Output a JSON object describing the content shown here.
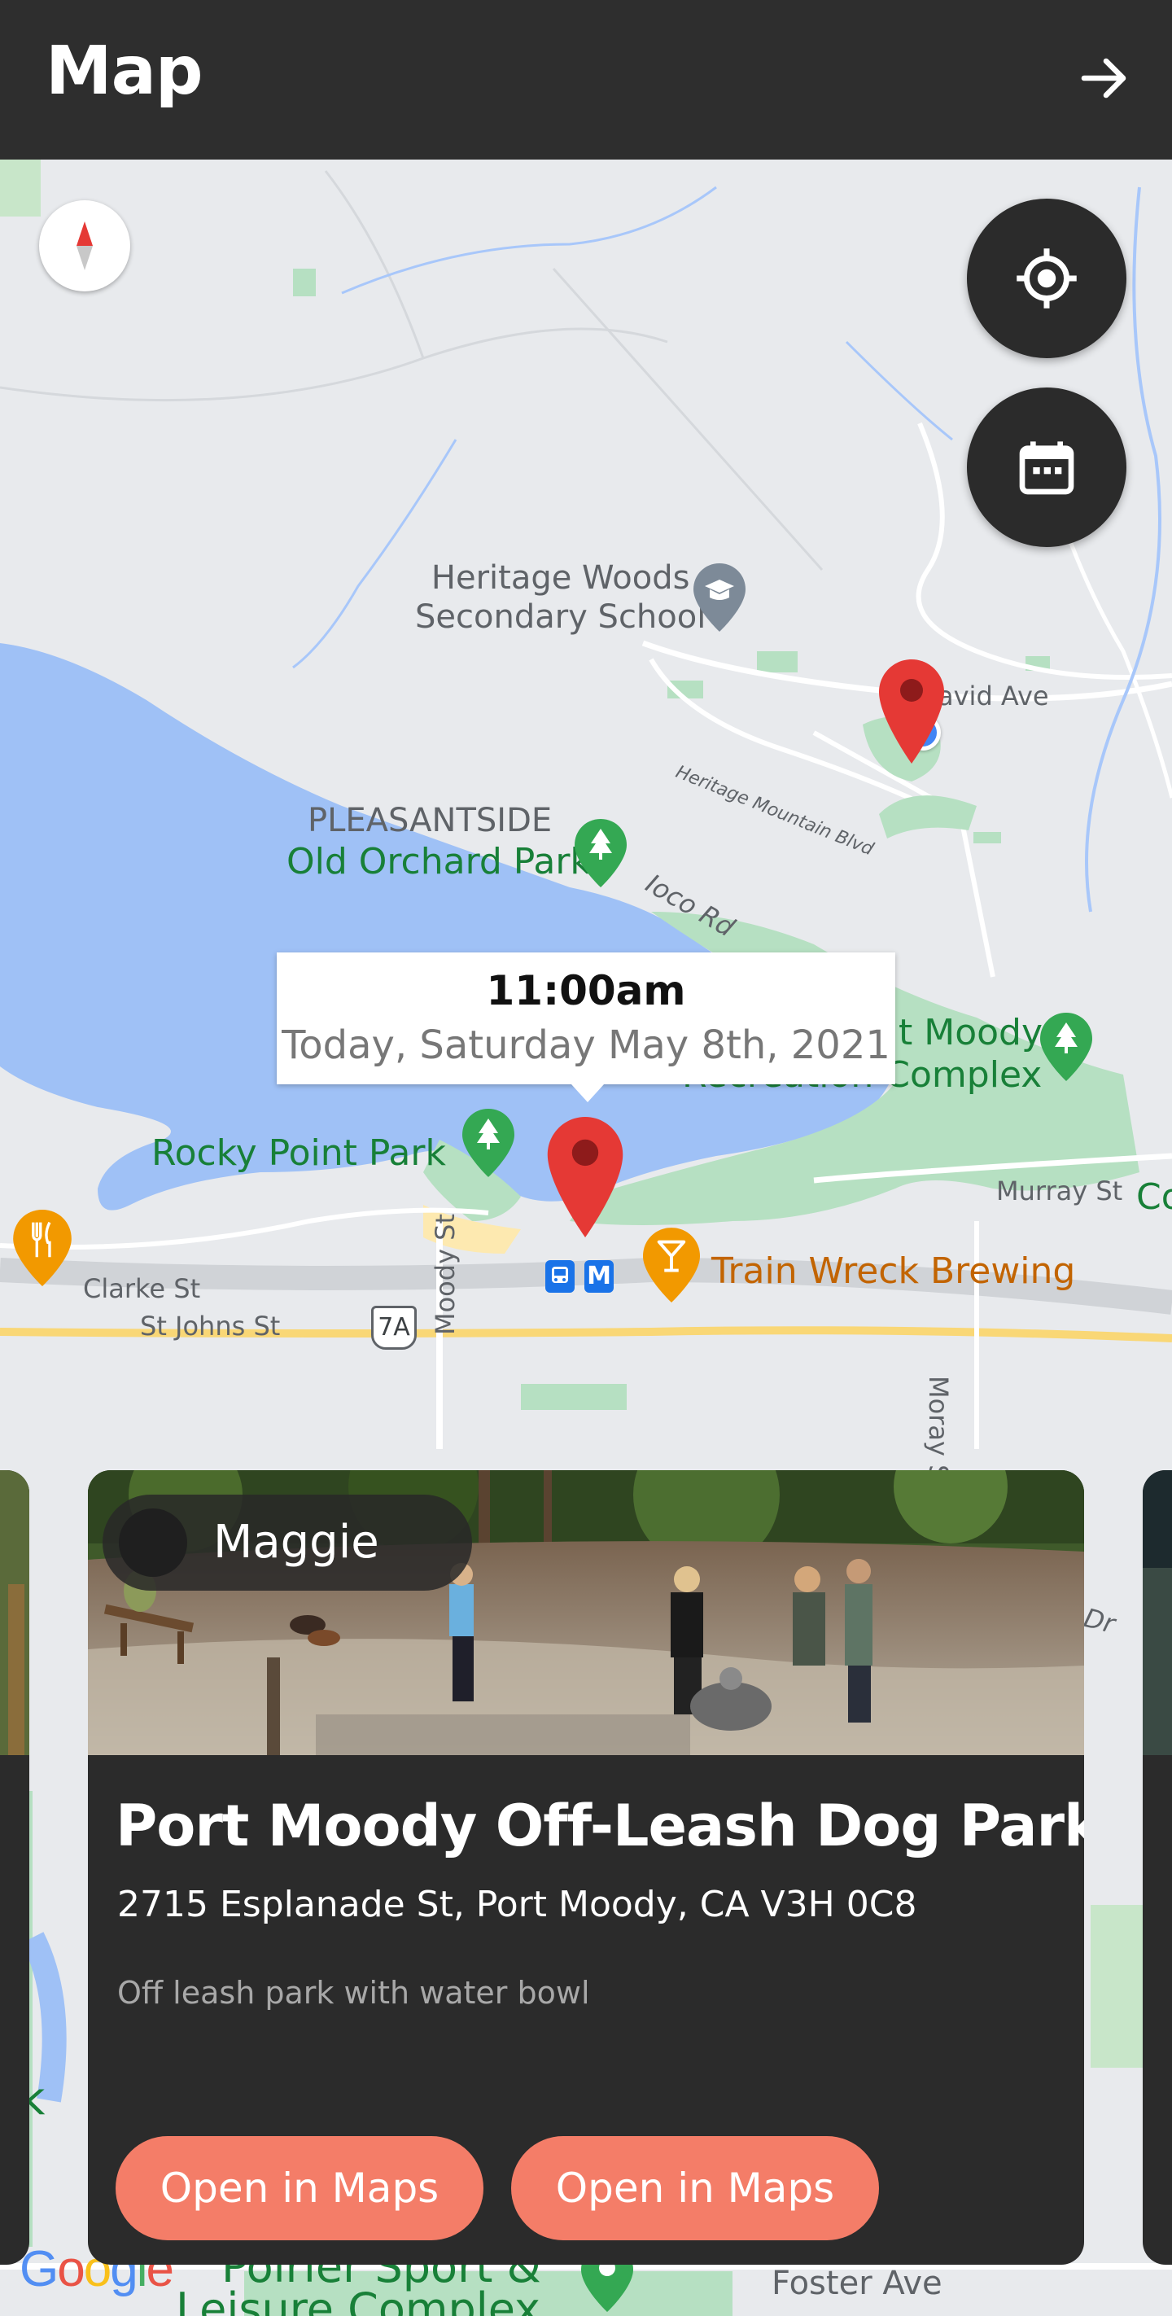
{
  "header": {
    "title": "Map",
    "arrow_icon": "arrow-right-icon"
  },
  "map": {
    "labels": {
      "school_1": "Heritage Woods",
      "school_2": "Secondary School",
      "david_ave": "avid Ave",
      "heritage_mountain": "Heritage Mountain Blvd",
      "pleasantside": "PLEASANTSIDE",
      "old_orchard": "Old Orchard Park",
      "ioco": "Ioco Rd",
      "recreation_1": "t Moody",
      "recreation_2": "Recreation Complex",
      "rocky_point": "Rocky Point Park",
      "murray": "Murray St",
      "co": "Co",
      "clarke": "Clarke St",
      "st_johns": "St Johns St",
      "moody_st": "Moody St",
      "highway": "7A",
      "train_wreck": "Train Wreck Brewing",
      "moray": "Moray St",
      "dr": "Dr",
      "foster": "Foster Ave",
      "poirier_1": "Poirier Sport &",
      "poirier_2": "Leisure Complex",
      "google": "Google",
      "rk": "rk"
    },
    "colors": {
      "water": "#9fc1f6",
      "park": "#b6e0c2",
      "road_major": "#f9d776",
      "land": "#e8eaed",
      "pin": "#e53935",
      "park_marker": "#34a853",
      "food_marker": "#f29900"
    }
  },
  "info_window": {
    "time": "11:00am",
    "date": "Today, Saturday May 8th, 2021"
  },
  "card": {
    "owner_name": "Maggie",
    "title": "Port Moody Off-Leash Dog Park",
    "address": "2715 Esplanade St, Port Moody, CA V3H 0C8",
    "description": "Off leash park with water bowl",
    "button_1": "Open in Maps",
    "button_2": "Open in Maps"
  }
}
